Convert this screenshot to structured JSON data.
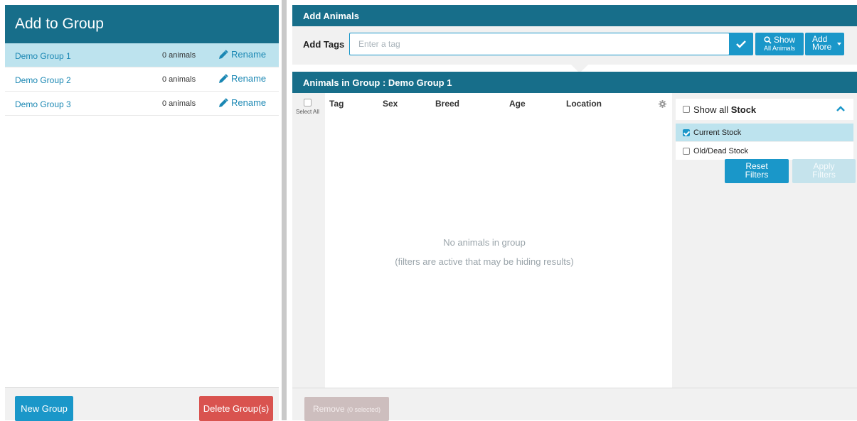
{
  "left": {
    "title": "Add to Group",
    "groups": [
      {
        "name": "Demo Group 1",
        "count": "0 animals",
        "rename": "Rename",
        "selected": true
      },
      {
        "name": "Demo Group 2",
        "count": "0 animals",
        "rename": "Rename",
        "selected": false
      },
      {
        "name": "Demo Group 3",
        "count": "0 animals",
        "rename": "Rename",
        "selected": false
      }
    ],
    "new_group_label": "New Group",
    "delete_label": "Delete Group(s)"
  },
  "add": {
    "title": "Add Animals",
    "tags_label": "Add Tags",
    "tag_placeholder": "Enter a tag",
    "show_line1": "Show",
    "show_line2": "All Animals",
    "more_line1": "Add",
    "more_line2": "More"
  },
  "group": {
    "title": "Animals in Group : Demo Group 1",
    "select_all": "Select All",
    "columns": [
      "Tag",
      "Sex",
      "Breed",
      "Age",
      "Location"
    ],
    "empty_line1": "No animals in group",
    "empty_line2": "(filters are active that may be hiding results)",
    "remove_label": "Remove",
    "remove_sub": "(0 selected)"
  },
  "filters": {
    "show_all_prefix": "Show all",
    "show_all_bold": "Stock",
    "current": "Current Stock",
    "current_checked": true,
    "old": "Old/Dead Stock",
    "old_checked": false,
    "reset_line1": "Reset",
    "reset_line2": "Filters",
    "apply_line1": "Apply",
    "apply_line2": "Filters"
  },
  "colors": {
    "header": "#176e8a",
    "accent": "#1a97c9",
    "selected_row": "#bde3ee",
    "danger": "#d9534f"
  }
}
